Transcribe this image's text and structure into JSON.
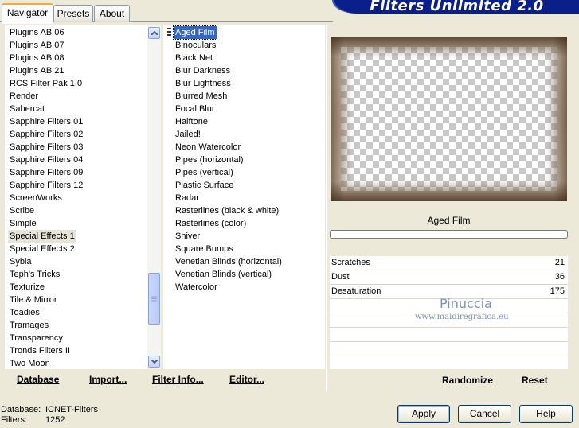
{
  "tabs": {
    "navigator": "Navigator",
    "presets": "Presets",
    "about": "About"
  },
  "banner": {
    "title": "Filters Unlimited 2.0"
  },
  "categories": [
    "Plugins AB 06",
    "Plugins AB 07",
    "Plugins AB 08",
    "Plugins AB 21",
    "RCS Filter Pak 1.0",
    "Render",
    "Sabercat",
    "Sapphire Filters 01",
    "Sapphire Filters 02",
    "Sapphire Filters 03",
    "Sapphire Filters 04",
    "Sapphire Filters 09",
    "Sapphire Filters 12",
    "ScreenWorks",
    "Scribe",
    "Simple",
    "Special Effects 1",
    "Special Effects 2",
    "Sybia",
    "Teph's Tricks",
    "Texturize",
    "Tile & Mirror",
    "Toadies",
    "Tramages",
    "Transparency",
    "Tronds Filters II",
    "Two Moon"
  ],
  "selected_category": "Special Effects 1",
  "filters": [
    "Aged Film",
    "Binoculars",
    "Black Net",
    "Blur Darkness",
    "Blur Lightness",
    "Blurred Mesh",
    "Focal Blur",
    "Halftone",
    "Jailed!",
    "Neon Watercolor",
    "Pipes (horizontal)",
    "Pipes (vertical)",
    "Plastic Surface",
    "Radar",
    "Rasterlines (black & white)",
    "Rasterlines (color)",
    "Shiver",
    "Square Bumps",
    "Venetian Blinds (horizontal)",
    "Venetian Blinds (vertical)",
    "Watercolor"
  ],
  "selected_filter": "Aged Film",
  "links": {
    "database": "Database",
    "import": "Import...",
    "filter_info": "Filter Info...",
    "editor": "Editor..."
  },
  "preview": {
    "filter_name": "Aged Film"
  },
  "params": [
    {
      "label": "Scratches",
      "value": "21"
    },
    {
      "label": "Dust",
      "value": "36"
    },
    {
      "label": "Desaturation",
      "value": "175"
    }
  ],
  "watermark": {
    "name": "Pinuccia",
    "url": "www.maidiregrafica.eu"
  },
  "actions": {
    "randomize": "Randomize",
    "reset": "Reset"
  },
  "status": {
    "database_label": "Database:",
    "database_value": "ICNET-Filters",
    "filters_label": "Filters:",
    "filters_value": "1252"
  },
  "buttons": {
    "apply": "Apply",
    "cancel": "Cancel",
    "help": "Help"
  }
}
